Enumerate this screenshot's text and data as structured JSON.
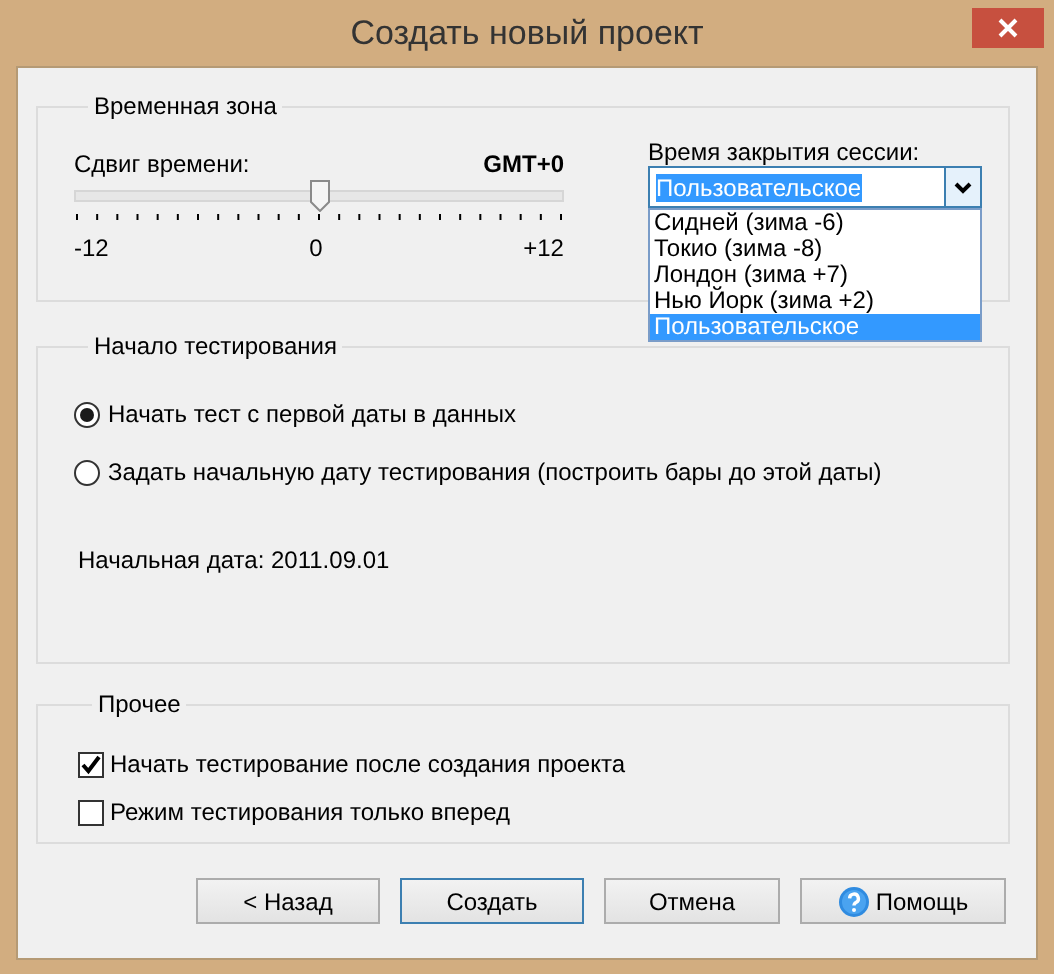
{
  "window": {
    "title": "Создать новый проект"
  },
  "timezone": {
    "title": "Временная зона",
    "shift_label": "Сдвиг времени:",
    "shift_value": "GMT+0",
    "slider": {
      "level": 0.5,
      "min_label": "-12",
      "mid_label": "0",
      "max_label": "+12"
    },
    "session_label": "Время закрытия сессии:",
    "session_combo": {
      "value": "Пользовательское",
      "expanded": true,
      "options": [
        {
          "label": "Сидней (зима -6)",
          "selected": false
        },
        {
          "label": "Токио (зима -8)",
          "selected": false
        },
        {
          "label": "Лондон (зима +7)",
          "selected": false
        },
        {
          "label": "Нью Йорк (зима +2)",
          "selected": false
        },
        {
          "label": "Пользовательское",
          "selected": true
        }
      ]
    }
  },
  "test_start": {
    "title": "Начало тестирования",
    "options": [
      {
        "label": "Начать тест с первой даты в данных",
        "selected": true
      },
      {
        "label": "Задать начальную дату тестирования (построить бары до этой даты)",
        "selected": false
      }
    ],
    "start_date": "Начальная дата: 2011.09.01"
  },
  "other": {
    "title": "Прочее",
    "checks": [
      {
        "label": "Начать тестирование после создания проекта",
        "checked": true
      },
      {
        "label": "Режим тестирования только вперед",
        "checked": false
      }
    ]
  },
  "buttons": [
    {
      "label": "< Назад",
      "kind": "plain"
    },
    {
      "label": "Создать",
      "kind": "default"
    },
    {
      "label": "Отмена",
      "kind": "plain"
    },
    {
      "label": "Помощь",
      "kind": "help"
    }
  ]
}
